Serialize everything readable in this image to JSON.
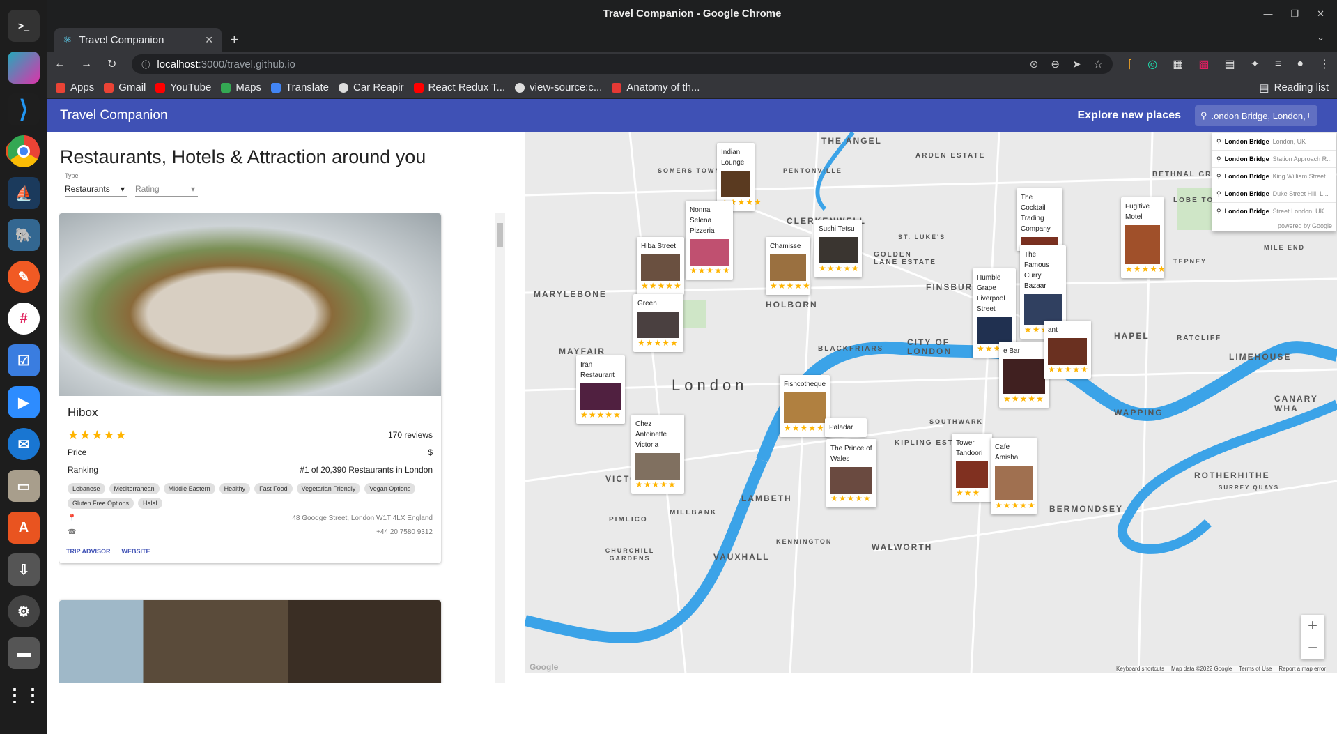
{
  "window": {
    "title": "Travel Companion - Google Chrome"
  },
  "tab": {
    "title": "Travel Companion"
  },
  "address": {
    "host": "localhost",
    "rest": ":3000/travel.github.io"
  },
  "bookmarks": [
    {
      "label": "Apps",
      "color": "#ea4335"
    },
    {
      "label": "Gmail",
      "color": "#ea4335"
    },
    {
      "label": "YouTube",
      "color": "#ff0000"
    },
    {
      "label": "Maps",
      "color": "#34a853"
    },
    {
      "label": "Translate",
      "color": "#4285f4"
    },
    {
      "label": "Car Reapir",
      "color": "#dddddd"
    },
    {
      "label": "React Redux T...",
      "color": "#ff0000"
    },
    {
      "label": "view-source:c...",
      "color": "#dddddd"
    },
    {
      "label": "Anatomy of th...",
      "color": "#e53935"
    }
  ],
  "reading_list": "Reading list",
  "app": {
    "title": "Travel Companion",
    "explore": "Explore new places",
    "search_value": ".ondon Bridge, London, U"
  },
  "list": {
    "heading": "Restaurants, Hotels & Attraction around you",
    "type_label": "Type",
    "type_value": "Restaurants",
    "rating_placeholder": "Rating"
  },
  "place": {
    "name": "Hibox",
    "stars": "★★★★★",
    "reviews": "170 reviews",
    "price_label": "Price",
    "price_value": "$",
    "ranking_label": "Ranking",
    "ranking_value": "#1 of 20,390 Restaurants in London",
    "cuisines": [
      "Lebanese",
      "Mediterranean",
      "Middle Eastern",
      "Healthy",
      "Fast Food",
      "Vegetarian Friendly",
      "Vegan Options",
      "Gluten Free Options",
      "Halal"
    ],
    "address": "48 Goodge Street, London W1T 4LX England",
    "phone": "+44 20 7580 9312",
    "link_trip": "TRIP ADVISOR",
    "link_web": "WEBSITE"
  },
  "map_labels": [
    "THE ANGEL",
    "ARDEN ESTATE",
    "SOMERS TOWN",
    "PENTONVILLE",
    "CLERKENWELL",
    "ST. LUKE'S",
    "GOLDEN LANE ESTATE",
    "BETHNAL GREEN",
    "LOBE TOWN",
    "MILE END",
    "TEPNEY",
    "MARYLEBONE",
    "HOLBORN",
    "FINSBURY",
    "HAPEL",
    "MAYFAIR",
    "BLACKFRIARS",
    "CITY OF LONDON",
    "RATCLIFF",
    "LIMEHOUSE",
    "London",
    "SOUTHWARK",
    "WAPPING",
    "CANARY WHA",
    "KIPLING ESTATE",
    "VICTORIA",
    "LAMBETH",
    "MILLBANK",
    "PIMLICO",
    "BERMONDSEY",
    "ROTHERHITHE",
    "SURREY QUAYS",
    "KENNINGTON",
    "CHURCHILL GARDENS",
    "VAUXHALL",
    "WALWORTH"
  ],
  "markers": [
    {
      "name": "Indian Lounge",
      "stars": "★★★★★"
    },
    {
      "name": "Nonna Selena Pizzeria",
      "stars": "★★★★★"
    },
    {
      "name": "Hiba Street",
      "stars": "★★★★★"
    },
    {
      "name": "Chamisse",
      "stars": "★★★★★"
    },
    {
      "name": "Sushi Tetsu",
      "stars": "★★★★★"
    },
    {
      "name": "The Cocktail Trading Company",
      "stars": ""
    },
    {
      "name": "Fugitive Motel",
      "stars": "★★★★★"
    },
    {
      "name": "The Famous Curry Bazaar",
      "stars": "★★★★★"
    },
    {
      "name": "Humble Grape Liverpool Street",
      "stars": "★★★★★"
    },
    {
      "name": "Green",
      "stars": "★★★★★"
    },
    {
      "name": "Iran Restaurant",
      "stars": "★★★★★"
    },
    {
      "name": "Fishcotheque",
      "stars": "★★★★★"
    },
    {
      "name": "Chez Antoinette Victoria",
      "stars": "★★★★★"
    },
    {
      "name": "The Prince of Wales",
      "stars": "★★★★★"
    },
    {
      "name": "Tower Tandoori",
      "stars": "★★★"
    },
    {
      "name": "Cafe Amisha",
      "stars": "★★★★★"
    },
    {
      "name": "Paladar",
      "stars": ""
    },
    {
      "name": "e Bar",
      "stars": "★★★★★"
    },
    {
      "name": "ant",
      "stars": "★★★★★"
    }
  ],
  "autocomplete": [
    {
      "main": "London Bridge",
      "sub": "London, UK"
    },
    {
      "main": "London Bridge",
      "sub": "Station Approach R..."
    },
    {
      "main": "London Bridge",
      "sub": "King William Street..."
    },
    {
      "main": "London Bridge",
      "sub": "Duke Street Hill, L..."
    },
    {
      "main": "London Bridge",
      "sub": "Street London, UK"
    }
  ],
  "powered": "powered by Google",
  "attribution": [
    "Keyboard shortcuts",
    "Map data ©2022 Google",
    "Terms of Use",
    "Report a map error"
  ],
  "google": "Google"
}
